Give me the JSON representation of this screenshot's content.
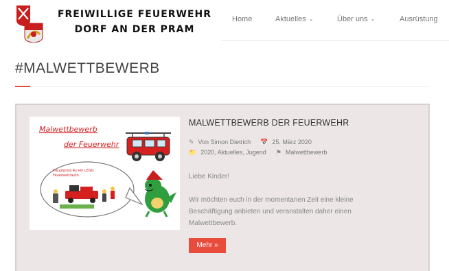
{
  "site": {
    "title_line1": "FREIWILLIGE FEUERWEHR",
    "title_line2": "DORF AN DER PRAM"
  },
  "nav": {
    "items": [
      {
        "label": "Home",
        "has_dropdown": false
      },
      {
        "label": "Aktuelles",
        "has_dropdown": true
      },
      {
        "label": "Über uns",
        "has_dropdown": true
      },
      {
        "label": "Ausrüstung",
        "has_dropdown": false
      }
    ]
  },
  "page": {
    "title": "#MALWETTBEWERB"
  },
  "post": {
    "title": "MALWETTBEWERB DER FEUERWEHR",
    "author": "Von Simon Dietrich",
    "date": "25. März 2020",
    "categories": "2020, Aktuelles, Jugend",
    "tag": "Malwettbewerb",
    "excerpt_p1": "Liebe Kinder!",
    "excerpt_p2_line1": "Wir möchten euch in der momentanen Zeit eine kleine",
    "excerpt_p2_line2": "Beschäftigung anbieten und veranstalten daher einen",
    "excerpt_p2_line3": "Malwettbewerb.",
    "more_label": "Mehr »",
    "thumb": {
      "heading1": "Malwettbewerb",
      "heading2": "der Feuerwehr",
      "bubble_line1": "Hauptpreis 4x ein LEGO",
      "bubble_line2": "Feuerwehrauto"
    }
  },
  "colors": {
    "accent": "#e84c3d",
    "card_bg": "#ece6e6",
    "fire_red": "#d62020"
  }
}
